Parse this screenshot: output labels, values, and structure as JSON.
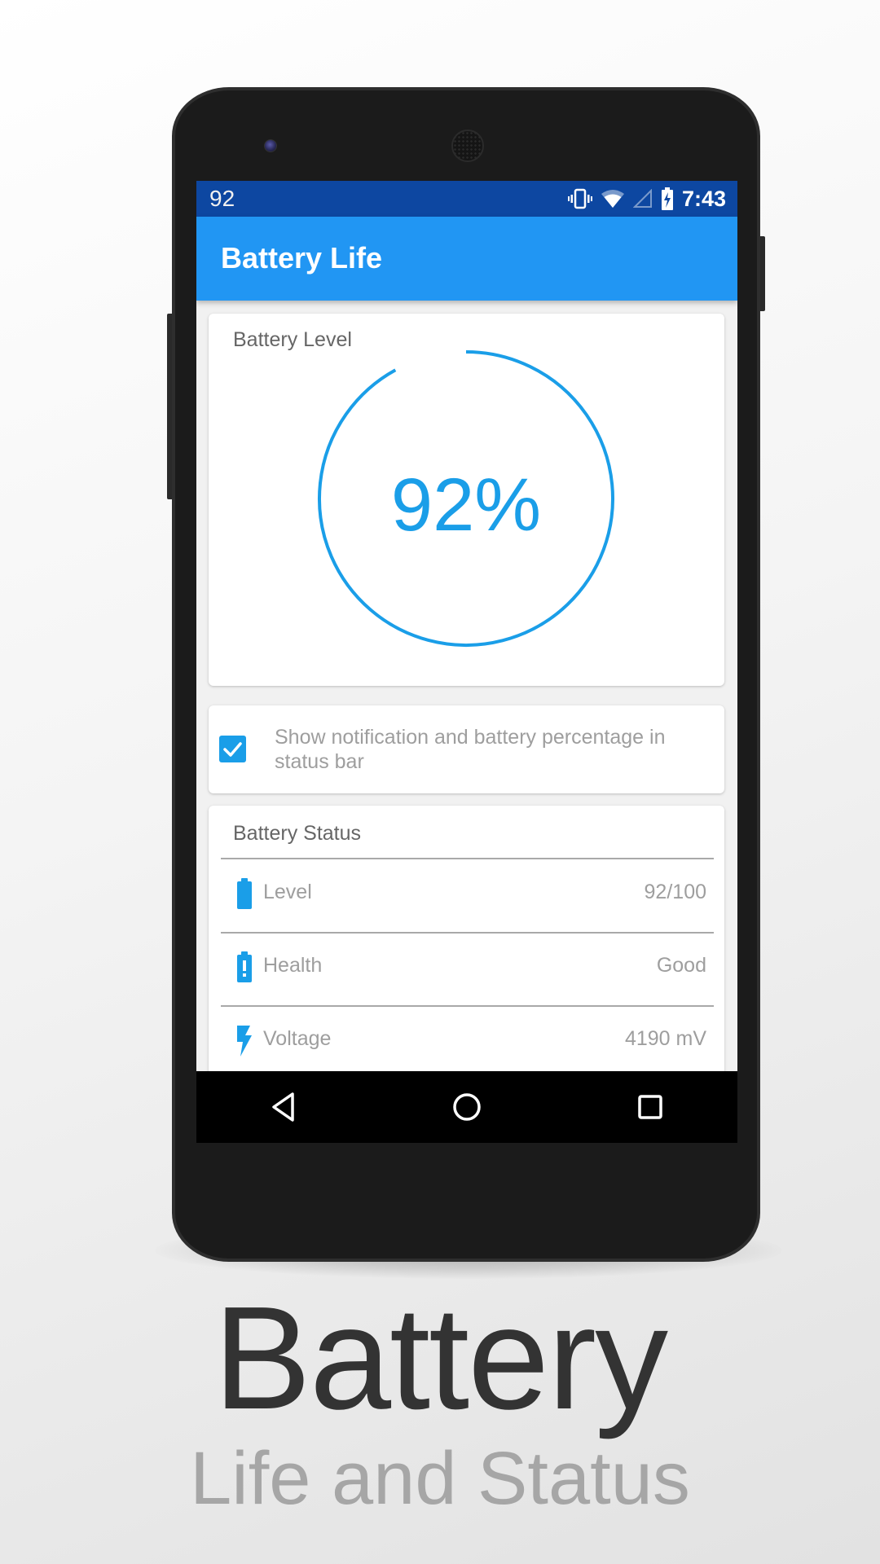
{
  "status_bar": {
    "notification_level": "92",
    "time": "7:43",
    "icons": [
      "vibrate-icon",
      "wifi-icon",
      "cell-signal-icon",
      "battery-charging-icon"
    ]
  },
  "app_bar": {
    "title": "Battery Life"
  },
  "battery_level_card": {
    "title": "Battery Level",
    "percent_label": "92%",
    "percent": 92,
    "accent_color": "#1a9ee8"
  },
  "notification_setting": {
    "label": "Show notification and battery percentage in status bar",
    "checked": true
  },
  "battery_status": {
    "title": "Battery Status",
    "rows": [
      {
        "icon": "battery-full-icon",
        "label": "Level",
        "value": "92/100"
      },
      {
        "icon": "battery-alert-icon",
        "label": "Health",
        "value": "Good"
      },
      {
        "icon": "flash-icon",
        "label": "Voltage",
        "value": "4190 mV"
      }
    ]
  },
  "nav_bar": {
    "buttons": [
      "back",
      "home",
      "recents"
    ]
  },
  "promo": {
    "headline": "Battery",
    "subheadline": "Life and Status"
  },
  "colors": {
    "status_bar": "#0d47a1",
    "app_bar": "#2196f3",
    "accent": "#1a9ee8"
  }
}
